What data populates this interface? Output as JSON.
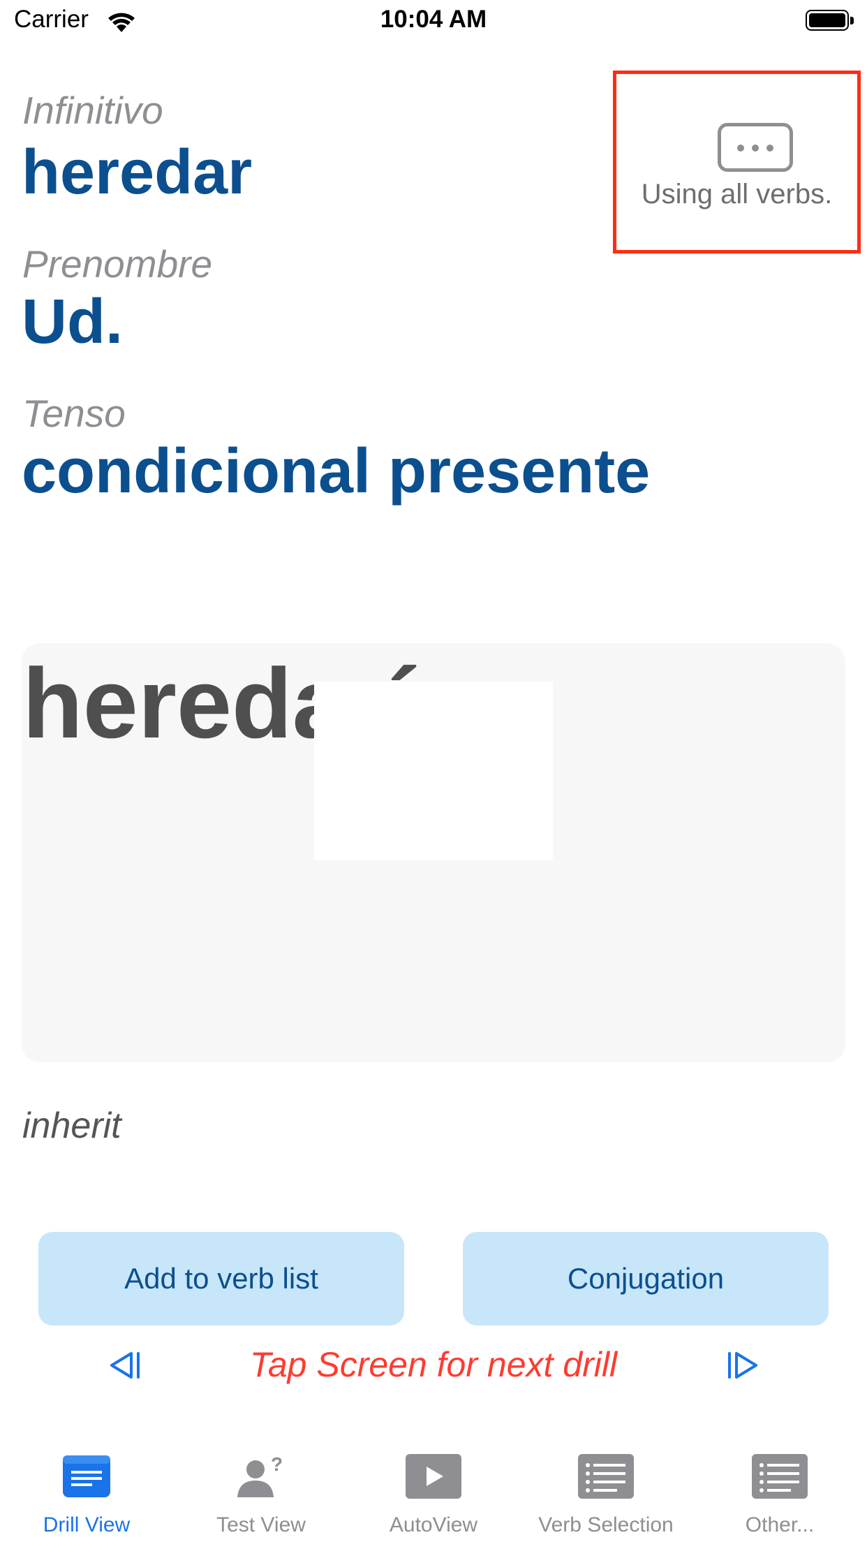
{
  "status_bar": {
    "carrier": "Carrier",
    "time": "10:04 AM"
  },
  "drill": {
    "infinitive_label": "Infinitivo",
    "infinitive": "heredar",
    "pronoun_label": "Prenombre",
    "pronoun": "Ud.",
    "tense_label": "Tenso",
    "tense": "condicional presente",
    "answer_partial": "heredaría",
    "translation": "inherit"
  },
  "verb_filter": {
    "label": "Using all verbs."
  },
  "actions": {
    "add_label": "Add to verb list",
    "conjugation_label": "Conjugation"
  },
  "hint": "Tap Screen for next drill",
  "tabs": [
    {
      "label": "Drill View",
      "icon": "drill-view-icon",
      "active": true
    },
    {
      "label": "Test View",
      "icon": "test-view-icon",
      "active": false
    },
    {
      "label": "AutoView",
      "icon": "autoview-icon",
      "active": false
    },
    {
      "label": "Verb Selection",
      "icon": "verb-selection-icon",
      "active": false
    },
    {
      "label": "Other...",
      "icon": "other-icon",
      "active": false
    }
  ],
  "colors": {
    "accent": "#1a73e8",
    "value": "#0b4f8f",
    "hint": "#ff3b30",
    "button_bg": "#c7e6fa",
    "highlight": "#ff2d14"
  }
}
